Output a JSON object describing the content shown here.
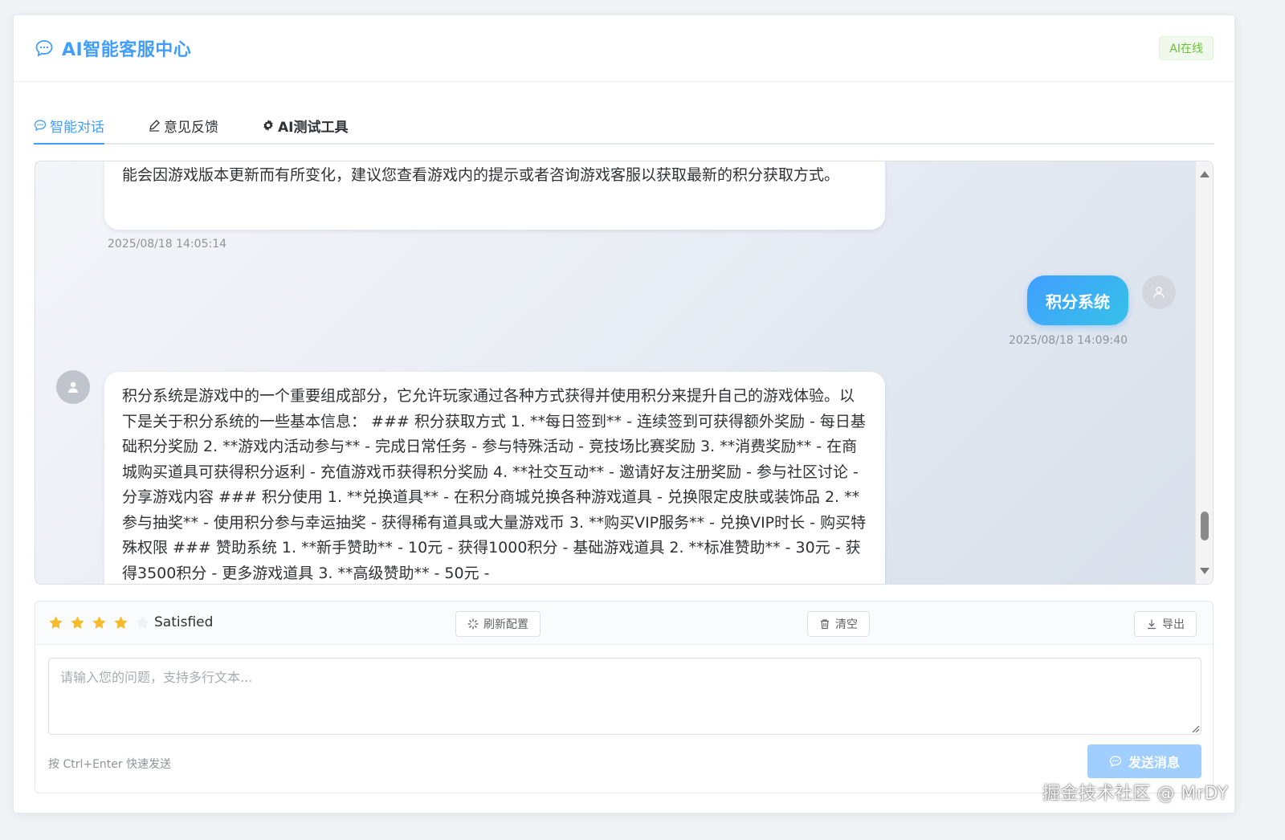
{
  "header": {
    "title": "AI智能客服中心",
    "icon": "chat-bubble-icon",
    "status_badge": "AI在线"
  },
  "tabs": [
    {
      "label": "智能对话",
      "icon": "chat-icon",
      "active": true
    },
    {
      "label": "意见反馈",
      "icon": "edit-icon",
      "active": false
    },
    {
      "label": "AI测试工具",
      "icon": "gear-icon",
      "active": false
    }
  ],
  "messages": [
    {
      "role": "bot",
      "text": "能会因游戏版本更新而有所变化，建议您查看游戏内的提示或者咨询游戏客服以获取最新的积分获取方式。",
      "time": "2025/08/18 14:05:14"
    },
    {
      "role": "user",
      "text": "积分系统",
      "time": "2025/08/18 14:09:40"
    },
    {
      "role": "bot",
      "text": "积分系统是游戏中的一个重要组成部分，它允许玩家通过各种方式获得并使用积分来提升自己的游戏体验。以下是关于积分系统的一些基本信息： ### 积分获取方式 1. **每日签到** - 连续签到可获得额外奖励 - 每日基础积分奖励 2. **游戏内活动参与** - 完成日常任务 - 参与特殊活动 - 竞技场比赛奖励 3. **消费奖励** - 在商城购买道具可获得积分返利 - 充值游戏币获得积分奖励 4. **社交互动** - 邀请好友注册奖励 - 参与社区讨论 - 分享游戏内容 ### 积分使用 1. **兑换道具** - 在积分商城兑换各种游戏道具 - 兑换限定皮肤或装饰品 2. **参与抽奖** - 使用积分参与幸运抽奖 - 获得稀有道具或大量游戏币 3. **购买VIP服务** - 兑换VIP时长 - 购买特殊权限 ### 赞助系统 1. **新手赞助** - 10元 - 获得1000积分 - 基础游戏道具 2. **标准赞助** - 30元 - 获得3500积分 - 更多游戏道具 3. **高级赞助** - 50元 -",
      "time": ""
    }
  ],
  "toolbar": {
    "rating": 4,
    "rating_max": 5,
    "rating_text": "Satisfied",
    "refresh_label": "刷新配置",
    "clear_label": "清空",
    "export_label": "导出"
  },
  "input": {
    "placeholder": "请输入您的问题，支持多行文本...",
    "value": "",
    "hint": "按 Ctrl+Enter 快速发送",
    "send_label": "发送消息"
  },
  "watermark": "掘金技术社区 @ MrDY",
  "colors": {
    "primary": "#409eff",
    "success": "#67c23a",
    "star": "#f7ba2a",
    "send_disabled": "#a0cfff"
  }
}
